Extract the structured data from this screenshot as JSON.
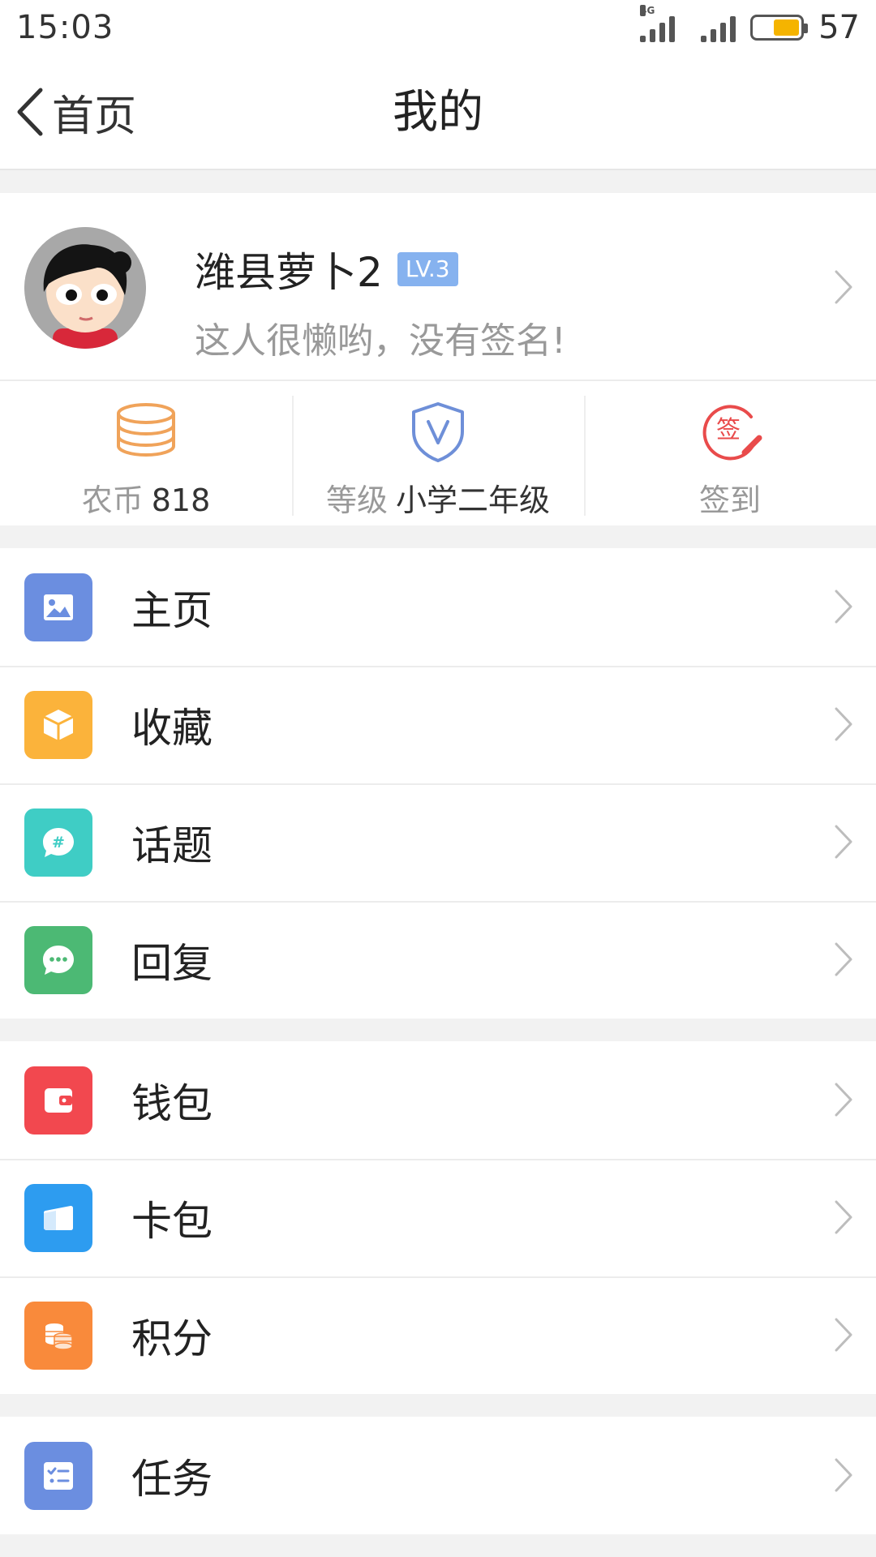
{
  "status_bar": {
    "time": "15:03",
    "network": "4G",
    "battery": "57",
    "battery_fill_fraction": 0.57
  },
  "nav": {
    "back_label": "首页",
    "title": "我的"
  },
  "profile": {
    "name": "潍县萝卜2",
    "level_badge": "LV.3",
    "bio": "这人很懒哟，没有签名!"
  },
  "stats": [
    {
      "icon": "coins-stack-icon",
      "label": "农币",
      "value": "818",
      "color": "#f0a35a"
    },
    {
      "icon": "shield-v-icon",
      "label": "等级",
      "value": "小学二年级",
      "color": "#6e8fd8"
    },
    {
      "icon": "sign-in-stamp-icon",
      "label": "签到",
      "value": "",
      "color": "#e94b4b"
    }
  ],
  "menu_groups": [
    [
      {
        "label": "主页",
        "icon": "image-icon",
        "color": "#6b8ee0"
      },
      {
        "label": "收藏",
        "icon": "box-icon",
        "color": "#fbb33b"
      },
      {
        "label": "话题",
        "icon": "hashtag-chat-icon",
        "color": "#3fcdc5"
      },
      {
        "label": "回复",
        "icon": "chat-bubble-icon",
        "color": "#4cb974"
      }
    ],
    [
      {
        "label": "钱包",
        "icon": "wallet-icon",
        "color": "#f2484f"
      },
      {
        "label": "卡包",
        "icon": "card-icon",
        "color": "#2d9cf0"
      },
      {
        "label": "积分",
        "icon": "points-coins-icon",
        "color": "#f98a3b"
      }
    ],
    [
      {
        "label": "任务",
        "icon": "checklist-icon",
        "color": "#6b8ee0"
      }
    ]
  ]
}
